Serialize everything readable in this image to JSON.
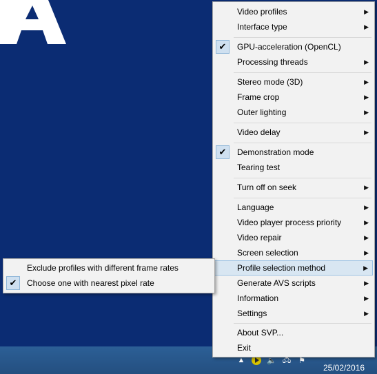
{
  "menu": {
    "items": [
      {
        "label": "Video profiles",
        "submenu": true,
        "checked": false
      },
      {
        "label": "Interface type",
        "submenu": true,
        "checked": false
      },
      {
        "label": "GPU-acceleration (OpenCL)",
        "submenu": false,
        "checked": true
      },
      {
        "label": "Processing threads",
        "submenu": true,
        "checked": false
      },
      {
        "label": "Stereo mode (3D)",
        "submenu": true,
        "checked": false
      },
      {
        "label": "Frame crop",
        "submenu": true,
        "checked": false
      },
      {
        "label": "Outer lighting",
        "submenu": true,
        "checked": false
      },
      {
        "label": "Video delay",
        "submenu": true,
        "checked": false
      },
      {
        "label": "Demonstration mode",
        "submenu": false,
        "checked": true
      },
      {
        "label": "Tearing test",
        "submenu": false,
        "checked": false
      },
      {
        "label": "Turn off on seek",
        "submenu": true,
        "checked": false
      },
      {
        "label": "Language",
        "submenu": true,
        "checked": false
      },
      {
        "label": "Video player process priority",
        "submenu": true,
        "checked": false
      },
      {
        "label": "Video repair",
        "submenu": true,
        "checked": false
      },
      {
        "label": "Screen selection",
        "submenu": true,
        "checked": false
      },
      {
        "label": "Profile selection method",
        "submenu": true,
        "checked": false,
        "highlighted": true
      },
      {
        "label": "Generate AVS scripts",
        "submenu": true,
        "checked": false
      },
      {
        "label": "Information",
        "submenu": true,
        "checked": false
      },
      {
        "label": "Settings",
        "submenu": true,
        "checked": false
      },
      {
        "label": "About SVP...",
        "submenu": false,
        "checked": false
      },
      {
        "label": "Exit",
        "submenu": false,
        "checked": false
      }
    ]
  },
  "submenu": {
    "items": [
      {
        "label": "Exclude profiles with different frame rates",
        "checked": false
      },
      {
        "label": "Choose one with nearest pixel rate",
        "checked": true
      }
    ]
  },
  "taskbar": {
    "date": "25/02/2016"
  },
  "icons": {
    "arrow": "chevron-right-icon",
    "check": "check-icon",
    "tray": [
      "chevron-up-icon",
      "svp-play-icon",
      "volume-icon",
      "network-icon",
      "flag-icon"
    ]
  },
  "colors": {
    "desktop": "#0b2c73",
    "menu_bg": "#f2f2f2",
    "highlight": "#d8e6f2",
    "taskbar": "#2c5f96"
  }
}
